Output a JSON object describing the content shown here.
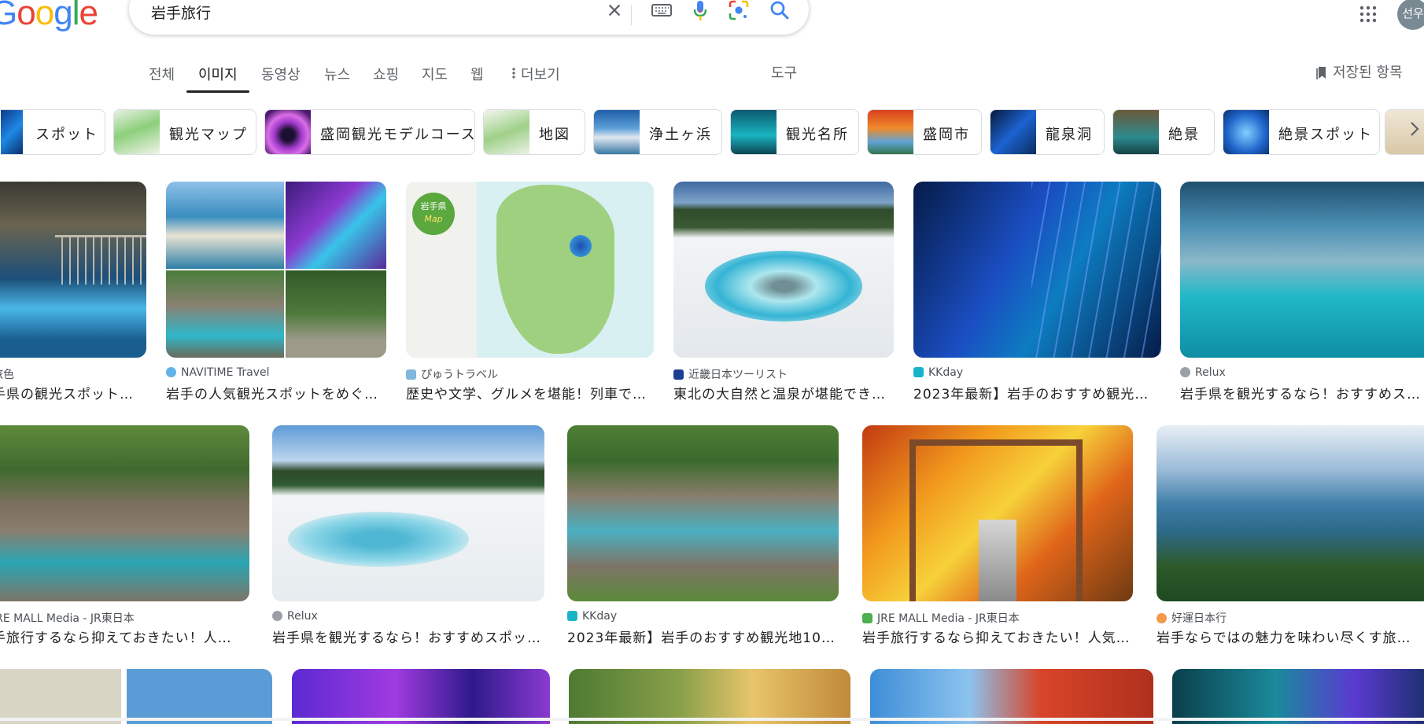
{
  "logo": {
    "letters": [
      "G",
      "o",
      "o",
      "g",
      "l",
      "e"
    ],
    "colors": [
      "#4285F4",
      "#EA4335",
      "#FBBC05",
      "#4285F4",
      "#34A853",
      "#EA4335"
    ]
  },
  "search": {
    "query": "岩手旅行"
  },
  "avatar": {
    "initials": "선우"
  },
  "tabs": [
    "전체",
    "이미지",
    "동영상",
    "뉴스",
    "쇼핑",
    "지도",
    "웹",
    "더보기"
  ],
  "active_tab": "이미지",
  "tools_label": "도구",
  "saved_label": "저장된 항목",
  "chips": [
    "スポット",
    "観光マップ",
    "盛岡観光モデルコース",
    "地図",
    "浄土ヶ浜",
    "観光名所",
    "盛岡市",
    "龍泉洞",
    "絶景",
    "絶景スポット"
  ],
  "results_row1": [
    {
      "source": "旅色",
      "title": "手県の観光スポット…"
    },
    {
      "source": "NAVITIME Travel",
      "title": "岩手の人気観光スポットをめぐ…"
    },
    {
      "source": "ぴゅうトラベル",
      "title": "歴史や文学、グルメを堪能！列車で…"
    },
    {
      "source": "近畿日本ツーリスト",
      "title": "東北の大自然と温泉が堪能でき…"
    },
    {
      "source": "KKday",
      "title": "2023年最新】岩手のおすすめ観光地…"
    },
    {
      "source": "Relux",
      "title": "岩手県を観光するなら！おすすめス…"
    }
  ],
  "results_row2": [
    {
      "source": "JRE MALL Media - JR東日本",
      "title": "手旅行するなら抑えておきたい！人気…"
    },
    {
      "source": "Relux",
      "title": "岩手県を観光するなら！おすすめスポッ…"
    },
    {
      "source": "KKday",
      "title": "2023年最新】岩手のおすすめ観光地10選…"
    },
    {
      "source": "JRE MALL Media - JR東日本",
      "title": "岩手旅行するなら抑えておきたい！人気…"
    },
    {
      "source": "好運日本行",
      "title": "岩手ならではの魅力を味わい尽くす旅行…"
    }
  ],
  "map_image_label": {
    "prefecture": "岩手県",
    "sub": "Map"
  },
  "colors": {
    "accent": "#1a73e8",
    "text": "#202124",
    "muted": "#5f6368"
  }
}
